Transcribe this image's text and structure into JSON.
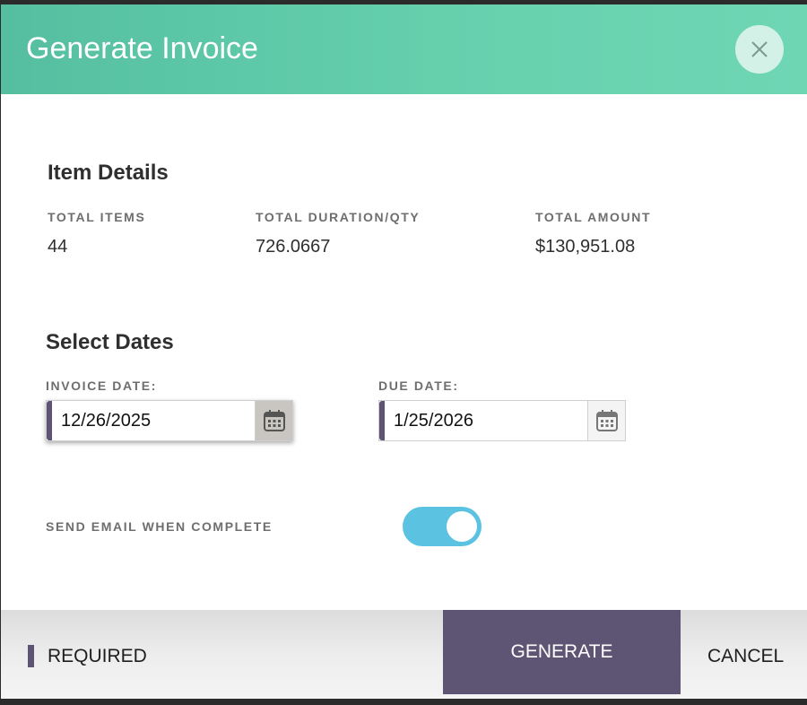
{
  "dialog": {
    "title": "Generate Invoice"
  },
  "item_details": {
    "heading": "Item Details",
    "total_items_label": "TOTAL ITEMS",
    "total_items_value": "44",
    "total_duration_label": "TOTAL DURATION/QTY",
    "total_duration_value": "726.0667",
    "total_amount_label": "TOTAL AMOUNT",
    "total_amount_value": "$130,951.08"
  },
  "dates": {
    "heading": "Select Dates",
    "invoice_date_label": "INVOICE DATE:",
    "invoice_date_value": "12/26/2025",
    "due_date_label": "DUE DATE:",
    "due_date_value": "1/25/2026"
  },
  "email": {
    "label": "SEND EMAIL WHEN COMPLETE",
    "enabled": true
  },
  "footer": {
    "required_label": "REQUIRED",
    "generate_label": "GENERATE",
    "cancel_label": "CANCEL"
  },
  "colors": {
    "header_green": "#66d0ad",
    "required_purple": "#5e5275",
    "generate_purple": "#5e5474",
    "toggle_blue": "#5bc3e1"
  },
  "icons": {
    "close": "close-icon",
    "calendar": "calendar-icon"
  }
}
